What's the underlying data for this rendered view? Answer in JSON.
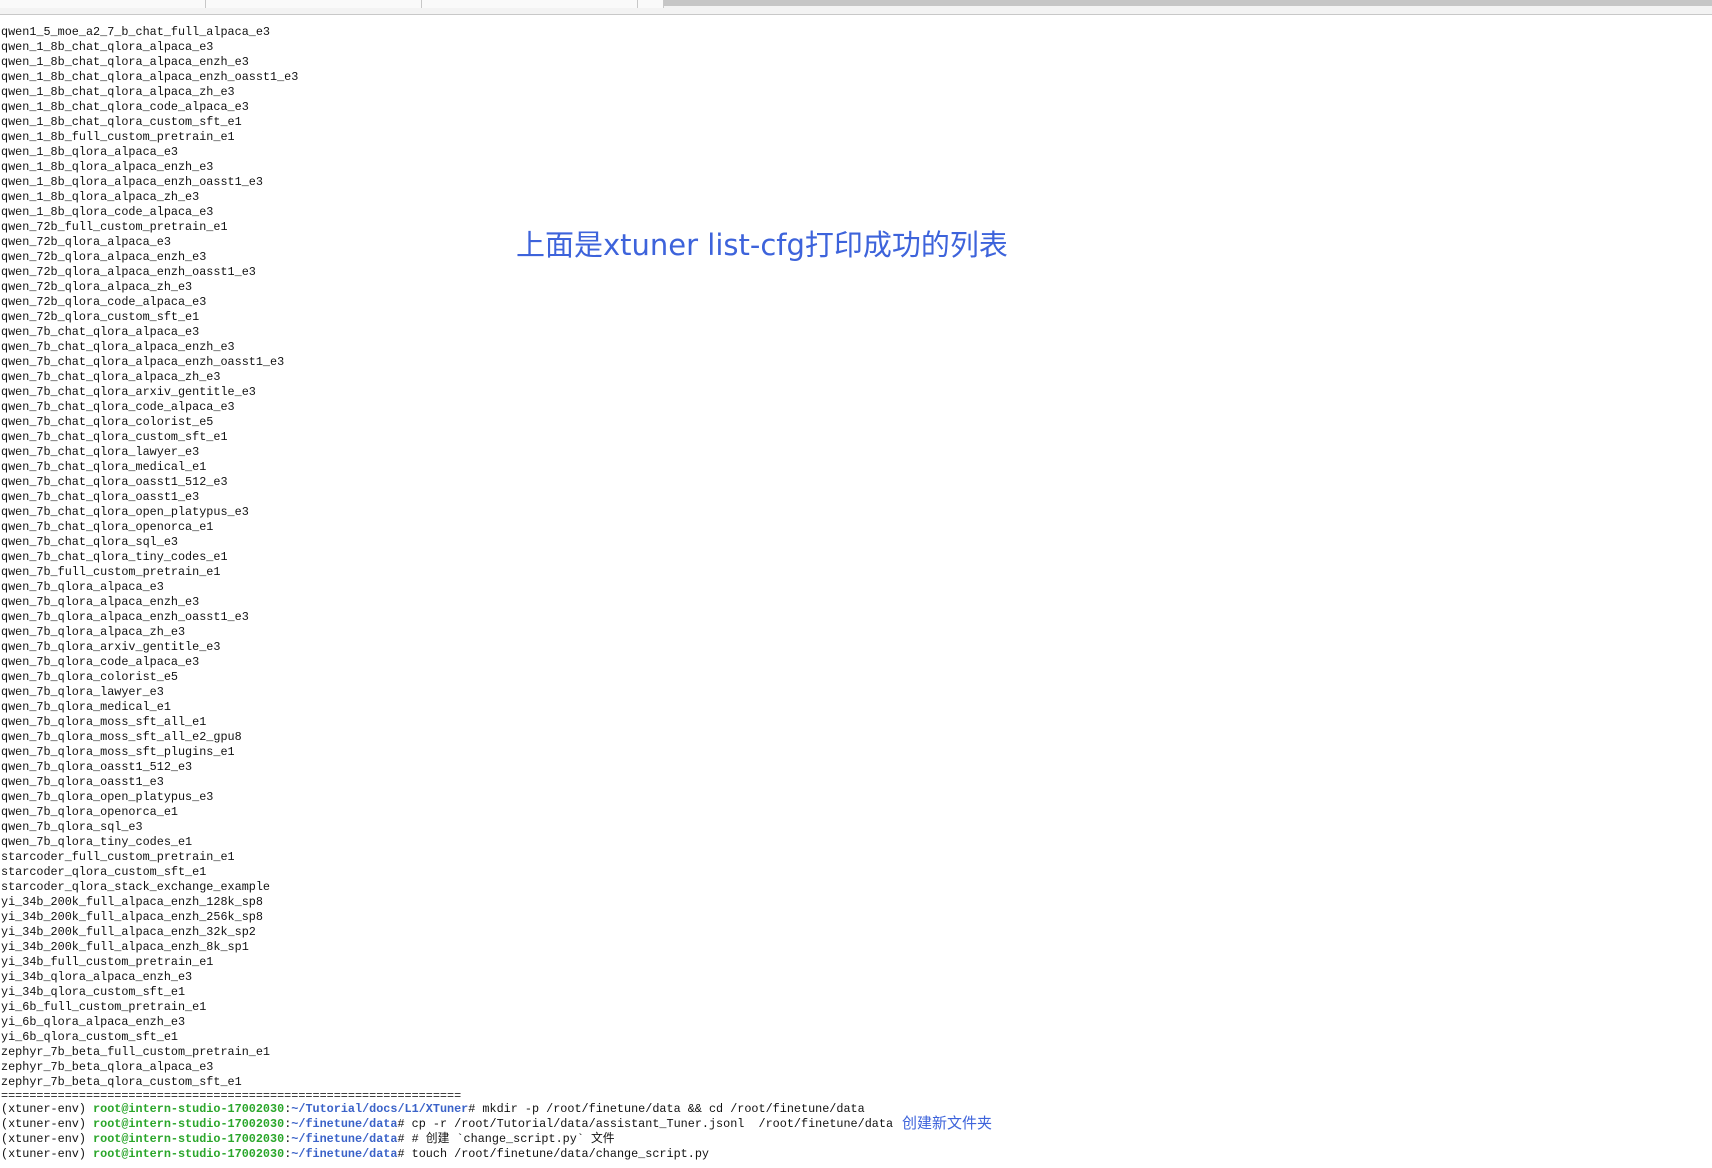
{
  "terminal": {
    "config_list": [
      "qwen1_5_moe_a2_7_b_chat_full_alpaca_e3",
      "qwen_1_8b_chat_qlora_alpaca_e3",
      "qwen_1_8b_chat_qlora_alpaca_enzh_e3",
      "qwen_1_8b_chat_qlora_alpaca_enzh_oasst1_e3",
      "qwen_1_8b_chat_qlora_alpaca_zh_e3",
      "qwen_1_8b_chat_qlora_code_alpaca_e3",
      "qwen_1_8b_chat_qlora_custom_sft_e1",
      "qwen_1_8b_full_custom_pretrain_e1",
      "qwen_1_8b_qlora_alpaca_e3",
      "qwen_1_8b_qlora_alpaca_enzh_e3",
      "qwen_1_8b_qlora_alpaca_enzh_oasst1_e3",
      "qwen_1_8b_qlora_alpaca_zh_e3",
      "qwen_1_8b_qlora_code_alpaca_e3",
      "qwen_72b_full_custom_pretrain_e1",
      "qwen_72b_qlora_alpaca_e3",
      "qwen_72b_qlora_alpaca_enzh_e3",
      "qwen_72b_qlora_alpaca_enzh_oasst1_e3",
      "qwen_72b_qlora_alpaca_zh_e3",
      "qwen_72b_qlora_code_alpaca_e3",
      "qwen_72b_qlora_custom_sft_e1",
      "qwen_7b_chat_qlora_alpaca_e3",
      "qwen_7b_chat_qlora_alpaca_enzh_e3",
      "qwen_7b_chat_qlora_alpaca_enzh_oasst1_e3",
      "qwen_7b_chat_qlora_alpaca_zh_e3",
      "qwen_7b_chat_qlora_arxiv_gentitle_e3",
      "qwen_7b_chat_qlora_code_alpaca_e3",
      "qwen_7b_chat_qlora_colorist_e5",
      "qwen_7b_chat_qlora_custom_sft_e1",
      "qwen_7b_chat_qlora_lawyer_e3",
      "qwen_7b_chat_qlora_medical_e1",
      "qwen_7b_chat_qlora_oasst1_512_e3",
      "qwen_7b_chat_qlora_oasst1_e3",
      "qwen_7b_chat_qlora_open_platypus_e3",
      "qwen_7b_chat_qlora_openorca_e1",
      "qwen_7b_chat_qlora_sql_e3",
      "qwen_7b_chat_qlora_tiny_codes_e1",
      "qwen_7b_full_custom_pretrain_e1",
      "qwen_7b_qlora_alpaca_e3",
      "qwen_7b_qlora_alpaca_enzh_e3",
      "qwen_7b_qlora_alpaca_enzh_oasst1_e3",
      "qwen_7b_qlora_alpaca_zh_e3",
      "qwen_7b_qlora_arxiv_gentitle_e3",
      "qwen_7b_qlora_code_alpaca_e3",
      "qwen_7b_qlora_colorist_e5",
      "qwen_7b_qlora_lawyer_e3",
      "qwen_7b_qlora_medical_e1",
      "qwen_7b_qlora_moss_sft_all_e1",
      "qwen_7b_qlora_moss_sft_all_e2_gpu8",
      "qwen_7b_qlora_moss_sft_plugins_e1",
      "qwen_7b_qlora_oasst1_512_e3",
      "qwen_7b_qlora_oasst1_e3",
      "qwen_7b_qlora_open_platypus_e3",
      "qwen_7b_qlora_openorca_e1",
      "qwen_7b_qlora_sql_e3",
      "qwen_7b_qlora_tiny_codes_e1",
      "starcoder_full_custom_pretrain_e1",
      "starcoder_qlora_custom_sft_e1",
      "starcoder_qlora_stack_exchange_example",
      "yi_34b_200k_full_alpaca_enzh_128k_sp8",
      "yi_34b_200k_full_alpaca_enzh_256k_sp8",
      "yi_34b_200k_full_alpaca_enzh_32k_sp2",
      "yi_34b_200k_full_alpaca_enzh_8k_sp1",
      "yi_34b_full_custom_pretrain_e1",
      "yi_34b_qlora_alpaca_enzh_e3",
      "yi_34b_qlora_custom_sft_e1",
      "yi_6b_full_custom_pretrain_e1",
      "yi_6b_qlora_alpaca_enzh_e3",
      "yi_6b_qlora_custom_sft_e1",
      "zephyr_7b_beta_full_custom_pretrain_e1",
      "zephyr_7b_beta_qlora_alpaca_e3",
      "zephyr_7b_beta_qlora_custom_sft_e1"
    ],
    "separator": "=================================================================",
    "commands": [
      {
        "env": "(xtuner-env) ",
        "user": "root@intern-studio-17002030",
        "colon": ":",
        "path": "~/Tutorial/docs/L1/XTuner",
        "cmd": "# mkdir -p /root/finetune/data && cd /root/finetune/data"
      },
      {
        "env": "(xtuner-env) ",
        "user": "root@intern-studio-17002030",
        "colon": ":",
        "path": "~/finetune/data",
        "cmd": "# cp -r /root/Tutorial/data/assistant_Tuner.jsonl  /root/finetune/data"
      },
      {
        "env": "(xtuner-env) ",
        "user": "root@intern-studio-17002030",
        "colon": ":",
        "path": "~/finetune/data",
        "cmd": "# # 创建 `change_script.py` 文件"
      },
      {
        "env": "(xtuner-env) ",
        "user": "root@intern-studio-17002030",
        "colon": ":",
        "path": "~/finetune/data",
        "cmd": "# touch /root/finetune/data/change_script.py"
      }
    ]
  },
  "annotations": {
    "list_note": "上面是xtuner list-cfg打印成功的列表",
    "folder_note": "创建新文件夹"
  },
  "colors": {
    "user": "#2aa62a",
    "path": "#3a62c8",
    "annotation": "#3d63db"
  }
}
